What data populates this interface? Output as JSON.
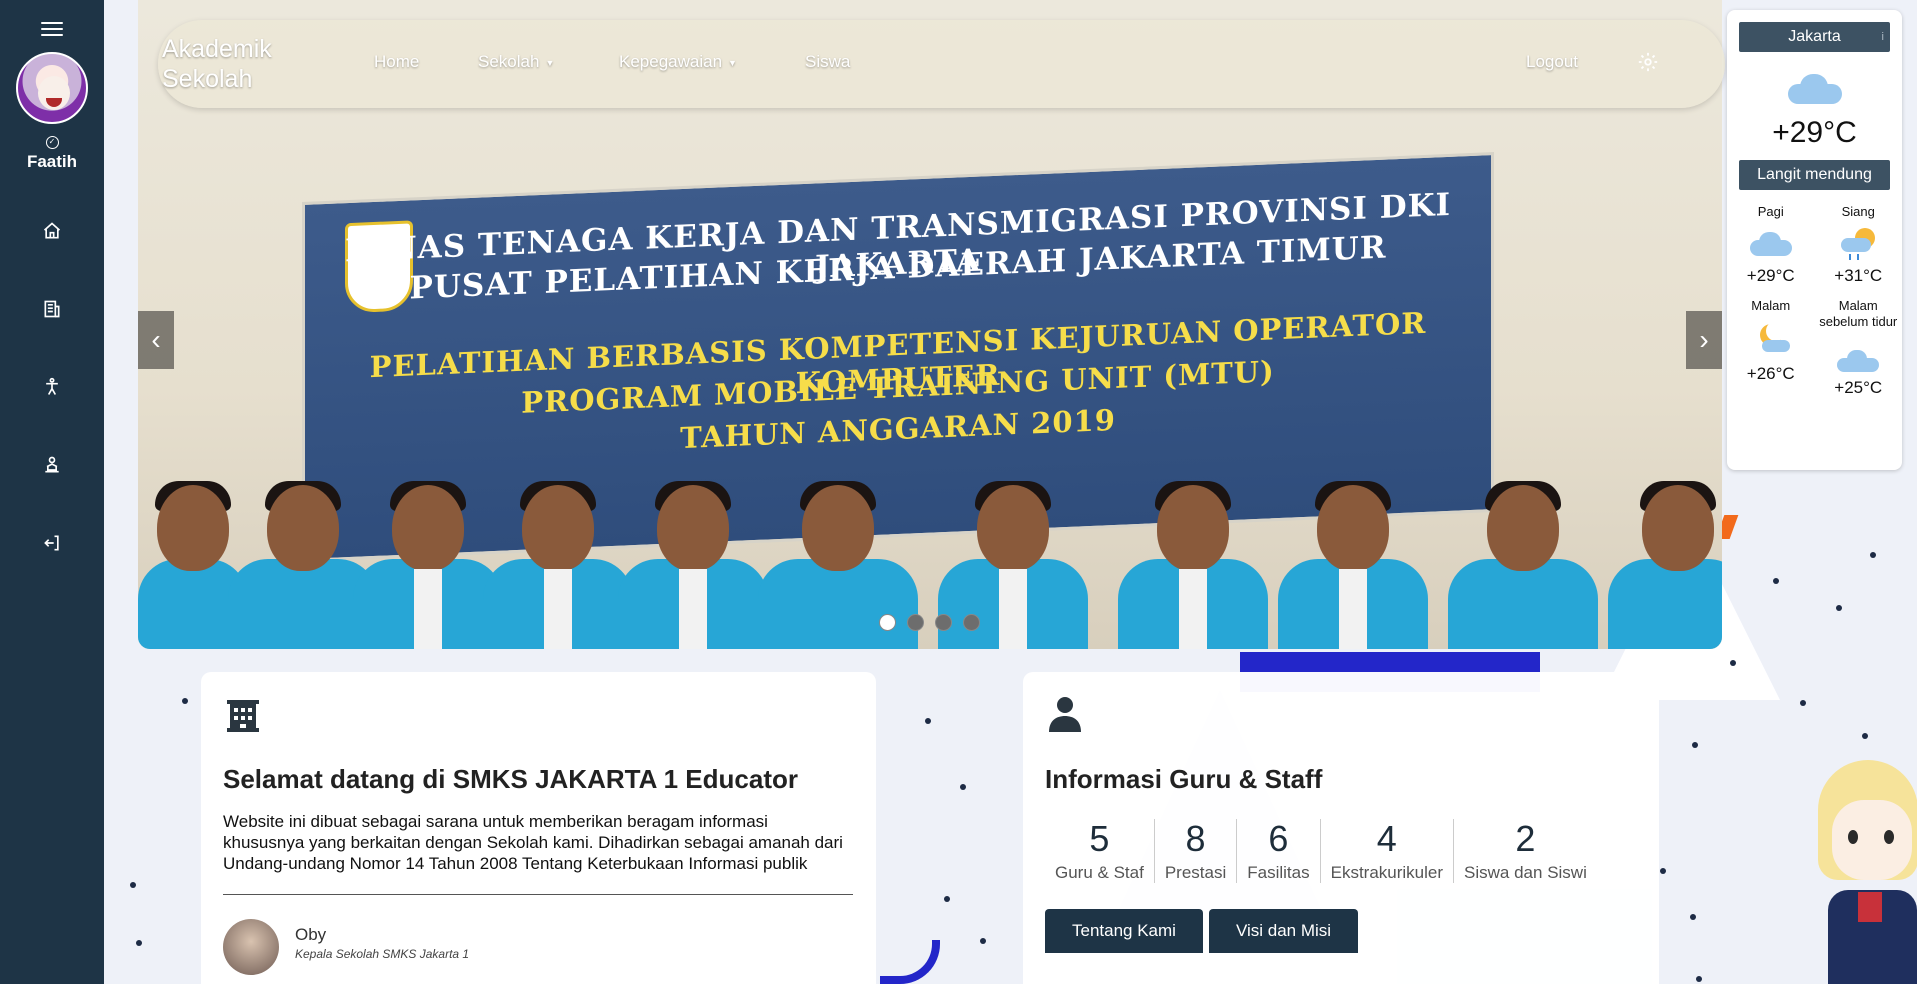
{
  "sidebar": {
    "user_name": "Faatih",
    "nav_items": [
      {
        "icon": "home-icon"
      },
      {
        "icon": "school-icon"
      },
      {
        "icon": "accessibility-icon"
      },
      {
        "icon": "student-icon"
      },
      {
        "icon": "logout-icon"
      }
    ]
  },
  "navbar": {
    "brand": "Akademik Sekolah",
    "items": [
      "Home",
      "Sekolah",
      "Kepegawaian",
      "Siswa"
    ],
    "logout": "Logout"
  },
  "banner": {
    "line1": "DINAS TENAGA KERJA DAN TRANSMIGRASI PROVINSI DKI JAKARTA",
    "line2": "PUSAT PELATIHAN KERJA DAERAH JAKARTA TIMUR",
    "line3": "PELATIHAN BERBASIS KOMPETENSI KEJURUAN OPERATOR KOMPUTER",
    "line4": "PROGRAM MOBILE TRAINING UNIT (MTU)",
    "line5": "TAHUN ANGGARAN 2019"
  },
  "carousel": {
    "prev": "‹",
    "next": "›",
    "slides": 4,
    "active_slide": 1
  },
  "weather": {
    "city": "Jakarta",
    "info": "i",
    "temp": "+29°C",
    "description": "Langit mendung",
    "periods": [
      {
        "label": "Pagi",
        "temp": "+29°C",
        "icon": "cloud-icon"
      },
      {
        "label": "Siang",
        "temp": "+31°C",
        "icon": "sun-rain-icon"
      },
      {
        "label": "Malam",
        "temp": "+26°C",
        "icon": "moon-cloud-icon"
      },
      {
        "label": "Malam sebelum tidur",
        "temp": "+25°C",
        "icon": "cloud-icon"
      }
    ]
  },
  "welcome_card": {
    "title": "Selamat datang di SMKS JAKARTA 1 Educator",
    "text": "Website ini dibuat sebagai sarana untuk memberikan beragam informasi khususnya yang berkaitan dengan Sekolah kami. Dihadirkan sebagai amanah dari Undang-undang Nomor 14 Tahun 2008 Tentang Keterbukaan Informasi publik",
    "author_name": "Oby",
    "author_role": "Kepala Sekolah SMKS Jakarta 1"
  },
  "staff_card": {
    "title": "Informasi Guru & Staff",
    "stats": [
      {
        "value": "5",
        "label": "Guru & Staf"
      },
      {
        "value": "8",
        "label": "Prestasi"
      },
      {
        "value": "6",
        "label": "Fasilitas"
      },
      {
        "value": "4",
        "label": "Ekstrakurikuler"
      },
      {
        "value": "2",
        "label": "Siswa dan Siswi"
      }
    ],
    "buttons": [
      "Tentang Kami",
      "Visi dan Misi"
    ]
  },
  "colors": {
    "sidebar": "#1e3446",
    "accent": "#3d5263",
    "button": "#1e3446"
  }
}
